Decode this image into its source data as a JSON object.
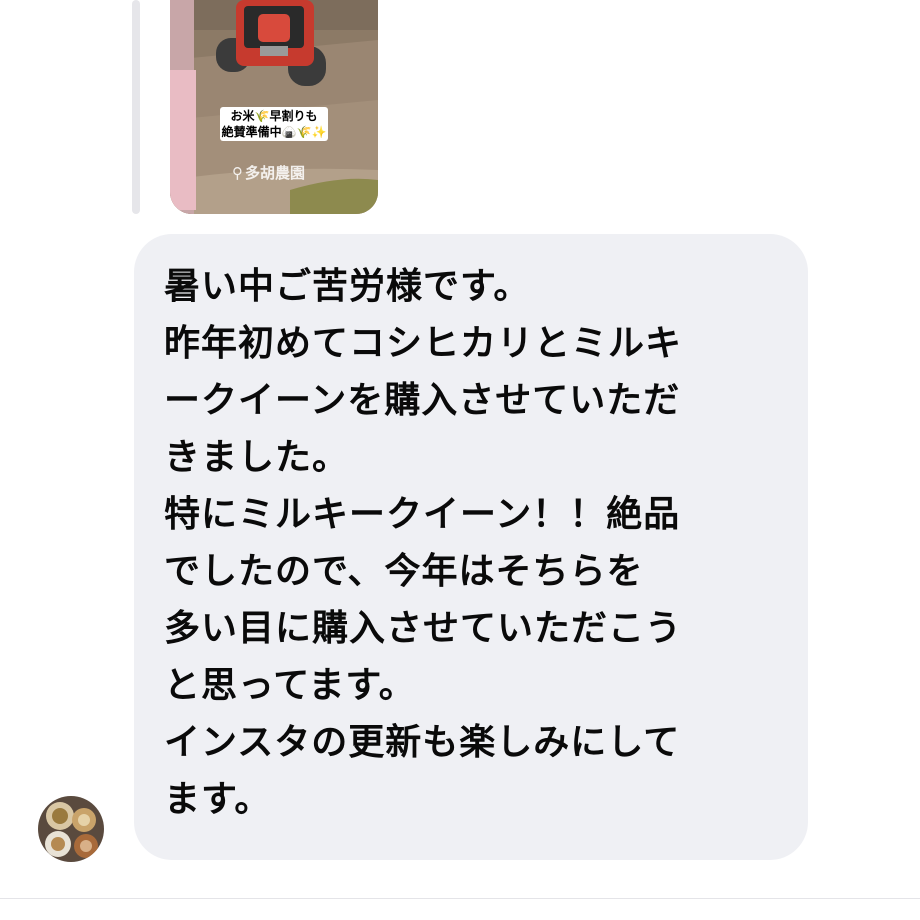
{
  "story_reply": {
    "badge_line1": "お米🌾早割りも",
    "badge_line2": "絶賛準備中🍙🌾✨",
    "location_pin": "⚲",
    "location_text": "多胡農園"
  },
  "message": {
    "lines": [
      "暑い中ご苦労様です。",
      "昨年初めてコシヒカリとミルキ",
      "ークイーンを購入させていただ",
      "きました。",
      "特にミルキークイーン！！絶品",
      "でしたので、今年はそちらを",
      "多い目に購入させていただこう",
      "と思ってます。",
      "インスタの更新も楽しみにして",
      "ます。"
    ]
  },
  "colors": {
    "bubble": "#eff0f4",
    "text": "#0a0a0a",
    "reply_bar": "#e6e6ea"
  }
}
